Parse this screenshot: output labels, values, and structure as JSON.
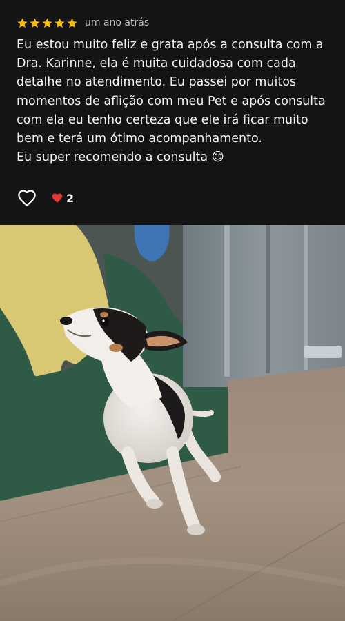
{
  "review": {
    "rating": 5,
    "time_ago": "um ano atrás",
    "text": "Eu estou muito feliz e grata após a consulta com a\nDra. Karinne, ela é muita cuidadosa com cada\ndetalhe no atendimento. Eu passei por muitos\nmomentos de aflição com meu Pet e após consulta\ncom ela eu tenho certeza que ele irá ficar muito\nbem e terá um ótimo acompanhamento.\nEu super recomendo a consulta 😊",
    "like_icon": "heart-outline-icon",
    "reaction_icon": "red-heart-icon",
    "reaction_count": "2"
  },
  "colors": {
    "background": "#141414",
    "star": "#fbbc04",
    "reaction_heart": "#e53935",
    "muted_text": "#bdbdbd"
  },
  "photo": {
    "subject": "small black-white-tan dog looking up"
  }
}
